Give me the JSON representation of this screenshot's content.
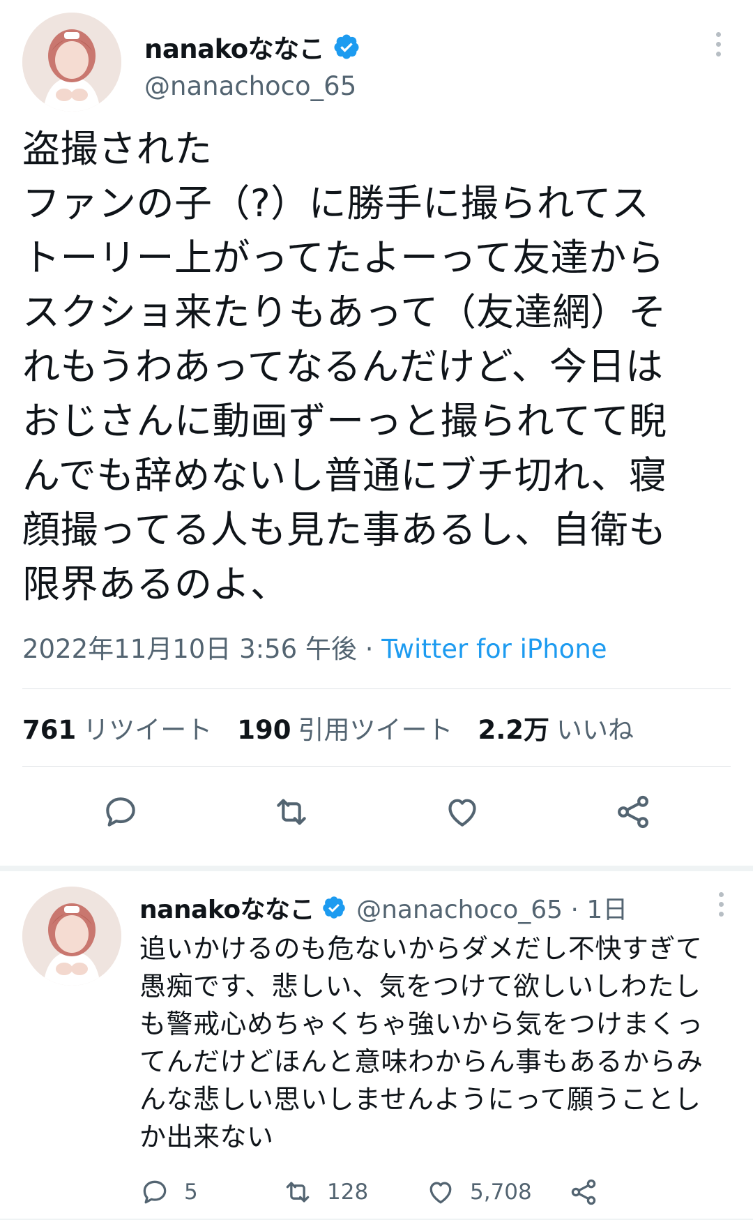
{
  "tweet": {
    "display_name": "nanakoななこ",
    "handle": "@nanachoco_65",
    "text": "盗撮された\nファンの子（?）に勝手に撮られてス\nトーリー上がってたよーって友達から\nスクショ来たりもあって（友達網）そ\nれもうわあってなるんだけど、今日は\nおじさんに動画ずーっと撮られてて睨\nんでも辞めないし普通にブチ切れ、寝\n顔撮ってる人も見た事あるし、自衛も\n限界あるのよ、",
    "timestamp": "2022年11月10日 3:56 午後",
    "separator": "·",
    "source": "Twitter for iPhone",
    "stats": {
      "retweets_count": "761",
      "retweets_label": "リツイート",
      "quotes_count": "190",
      "quotes_label": "引用ツイート",
      "likes_count": "2.2万",
      "likes_label": "いいね"
    },
    "accent_color": "#1d9bf0"
  },
  "reply": {
    "display_name": "nanakoななこ",
    "handle_time": "@nanachoco_65 · 1日",
    "text": "追いかけるのも危ないからダメだし不快すぎて\n愚痴です、悲しい、気をつけて欲しいしわたし\nも警戒心めちゃくちゃ強いから気をつけまくっ\nてんだけどほんと意味わからん事もあるからみ\nんな悲しい思いしませんようにって願うことし\nか出来ない",
    "reply_count": "5",
    "retweet_count": "128",
    "like_count": "5,708"
  },
  "icons": [
    "verified-badge-icon",
    "more-icon",
    "reply-icon",
    "retweet-icon",
    "like-icon",
    "share-icon"
  ]
}
